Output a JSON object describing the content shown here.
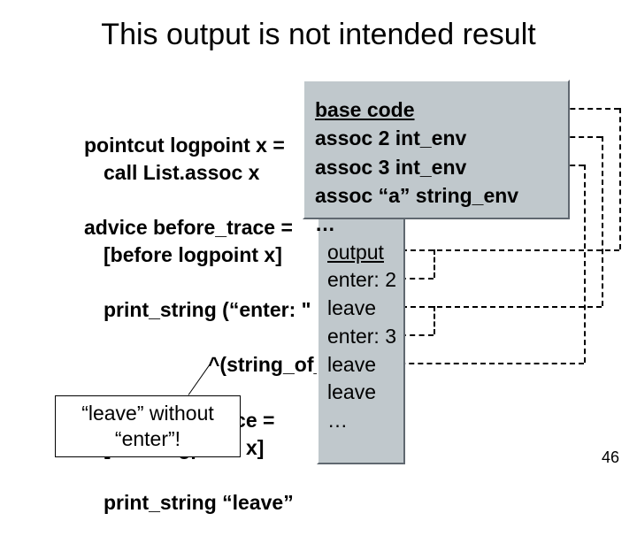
{
  "title": "This output is not intended result",
  "code": {
    "l1": "pointcut logpoint x =",
    "l2": "call List.assoc x",
    "l3": "advice before_trace =",
    "l4": "[before logpoint x]",
    "l5": "print_string (“enter: \"",
    "l6": "^(string_of_",
    "l7": "advice after_trace =",
    "l8": "[after logpoint x]",
    "l9": "print_string “leave”"
  },
  "note": {
    "l1": "“leave” without",
    "l2": "“enter”!"
  },
  "base": {
    "header": "base code",
    "l1": "assoc 2 int_env",
    "l2": "assoc 3 int_env",
    "l3": "assoc “a” string_env",
    "l4": "…"
  },
  "output": {
    "header": "output",
    "l1": "enter: 2",
    "l2": "leave",
    "l3": "enter: 3",
    "l4": "leave",
    "l5": "leave",
    "l6": "…"
  },
  "page": "46"
}
